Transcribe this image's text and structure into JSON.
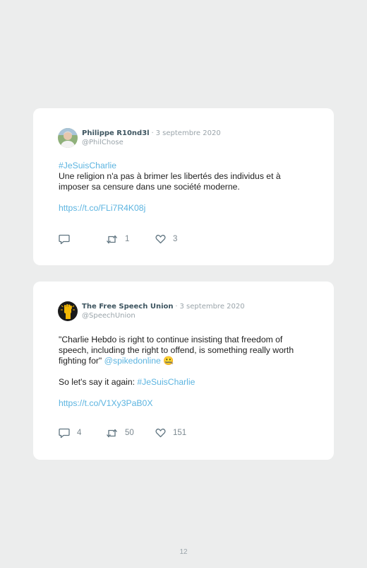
{
  "tweets": [
    {
      "author_name": "Philippe R10nd3l",
      "separator": "·",
      "date": "3 septembre 2020",
      "handle": "@PhilChose",
      "hashtag": "#JeSuisCharlie",
      "text": "Une religion n'a pas à brimer les libertés des individus et à imposer sa censure dans une société moderne.",
      "link": "https://t.co/FLi7R4K08j",
      "replies": "",
      "retweets": "1",
      "likes": "3",
      "avatar_icon": "profile-photo"
    },
    {
      "author_name": "The Free Speech Union",
      "separator": "·",
      "date": "3 septembre 2020",
      "handle": "@SpeechUnion",
      "quote": "\"Charlie Hebdo is right to continue insisting that freedom of speech, including the right to offend, is something really worth fighting for\"",
      "mention": "@spikedonline",
      "emoji": "🤐",
      "line2_prefix": "So let's say it again:",
      "hashtag": "#JeSuisCharlie",
      "link": "https://t.co/V1Xy3PaB0X",
      "replies": "4",
      "retweets": "50",
      "likes": "151",
      "avatar_icon": "raised-fist-logo"
    }
  ],
  "page_number": "12",
  "colors": {
    "background": "#eceded",
    "card": "#ffffff",
    "link": "#5cb4e0",
    "name": "#3e5560",
    "muted": "#9aa4aa",
    "icon": "#5f7480"
  },
  "icons": [
    "reply-icon",
    "retweet-icon",
    "like-icon"
  ]
}
